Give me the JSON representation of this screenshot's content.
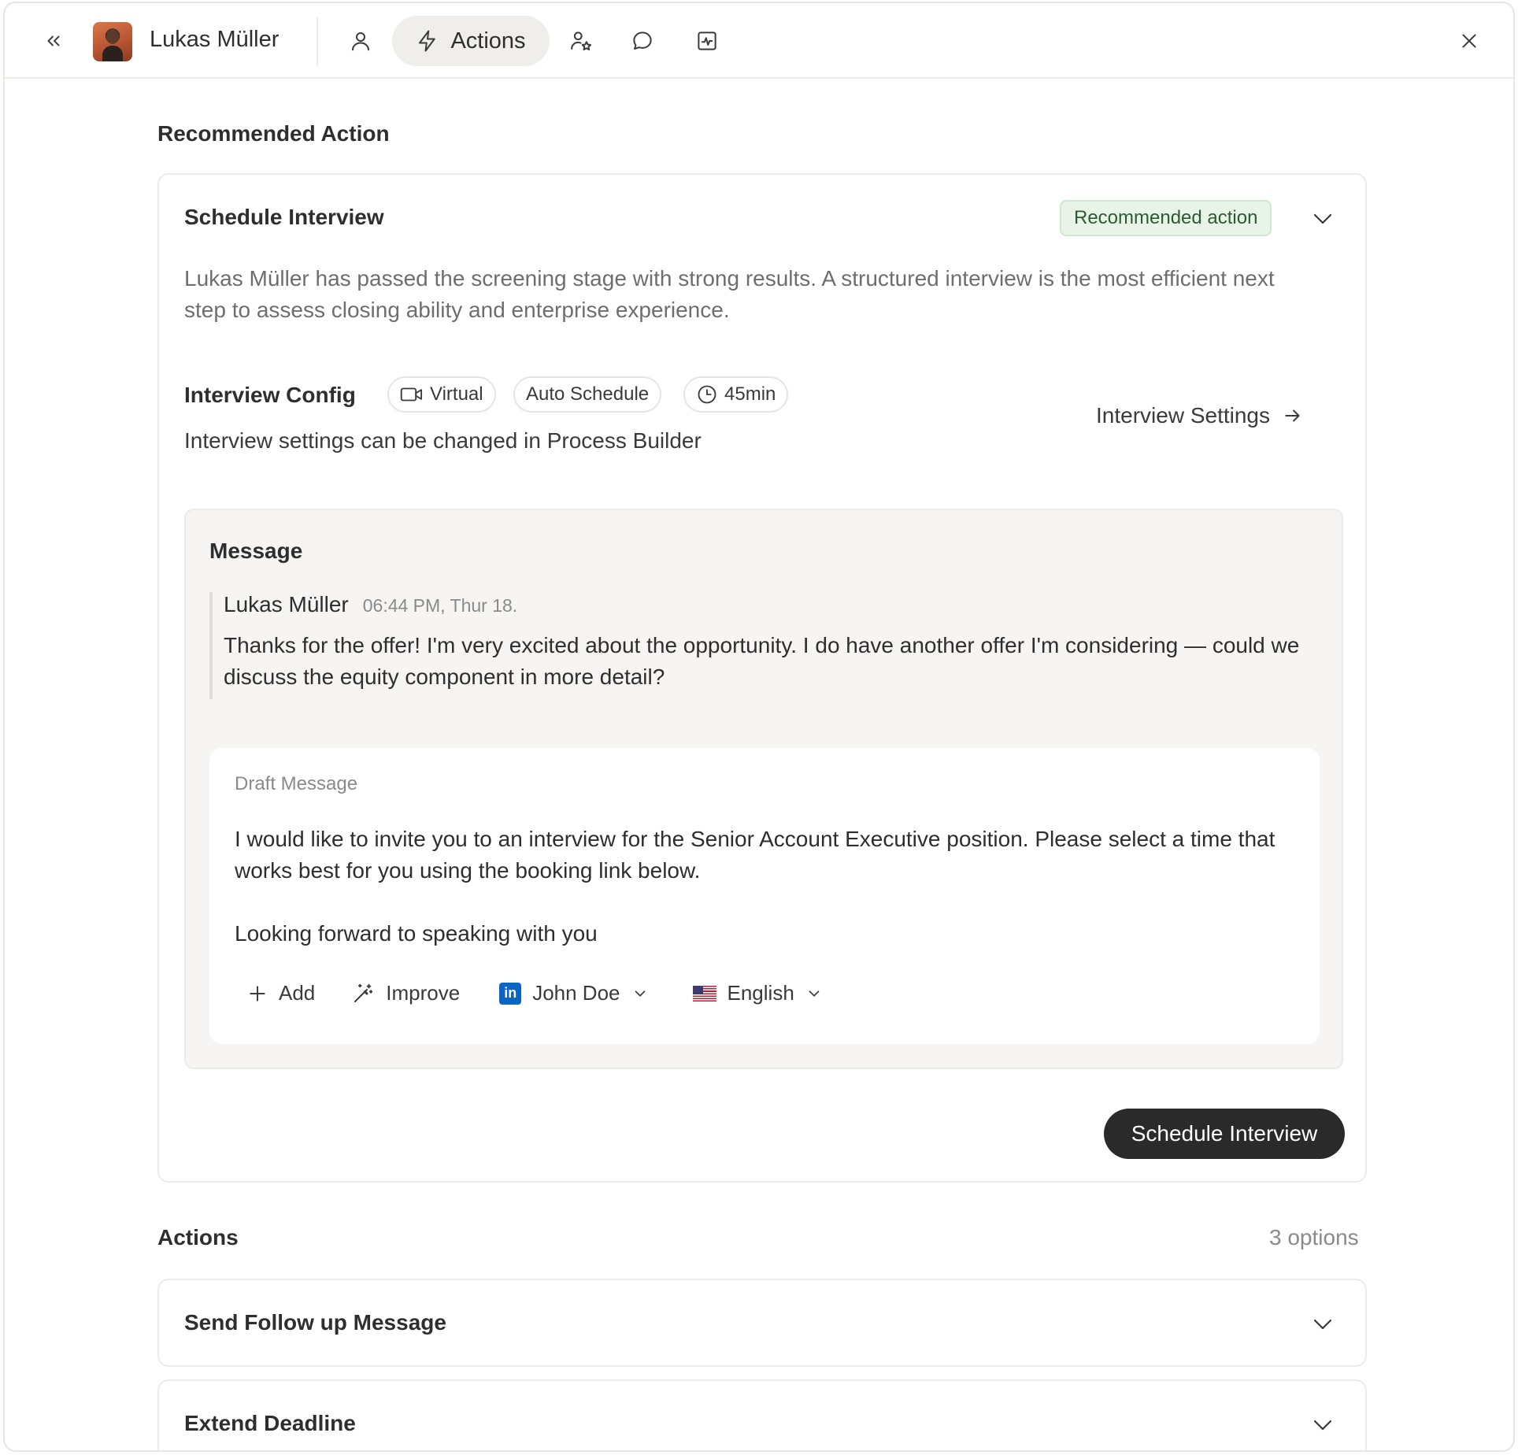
{
  "header": {
    "user_name": "Lukas Müller",
    "active_tab_label": "Actions",
    "tabs": [
      {
        "name": "profile",
        "icon": "person-icon"
      },
      {
        "name": "actions",
        "icon": "lightning-icon",
        "label": "Actions"
      },
      {
        "name": "feedback",
        "icon": "person-star-icon"
      },
      {
        "name": "messages",
        "icon": "chat-icon"
      },
      {
        "name": "activity",
        "icon": "activity-icon"
      }
    ]
  },
  "recommended": {
    "section_title": "Recommended Action",
    "card_title": "Schedule Interview",
    "badge": "Recommended action",
    "description": "Lukas Müller has passed the screening stage with strong results. A structured interview is the most efficient next step to assess closing ability and enterprise experience.",
    "config": {
      "label": "Interview Config",
      "chips": [
        "Virtual",
        "Auto Schedule",
        "45min"
      ],
      "note": "Interview settings can be changed in Process Builder",
      "settings_link": "Interview Settings"
    },
    "message": {
      "label": "Message",
      "quote": {
        "sender": "Lukas Müller",
        "time": "06:44 PM, Thur 18.",
        "text": "Thanks for the offer! I'm very excited about the opportunity. I do have another offer I'm considering — could we discuss the equity component in more detail?"
      },
      "draft": {
        "label": "Draft Message",
        "text": "I would like to invite you to an interview for the Senior Account Executive position. Please select a time that works best for you using the booking link below.\n\nLooking forward to speaking with you",
        "toolbar": {
          "add": "Add",
          "improve": "Improve",
          "sender": "John Doe",
          "language": "English"
        }
      }
    },
    "primary_button": "Schedule Interview"
  },
  "actions": {
    "section_title": "Actions",
    "count": "3 options",
    "items": [
      {
        "title": "Send Follow up Message"
      },
      {
        "title": "Extend Deadline"
      }
    ]
  },
  "colors": {
    "badge_bg": "#e8f4e8",
    "primary_button": "#2a2a2a",
    "linkedin": "#0a66c2"
  }
}
